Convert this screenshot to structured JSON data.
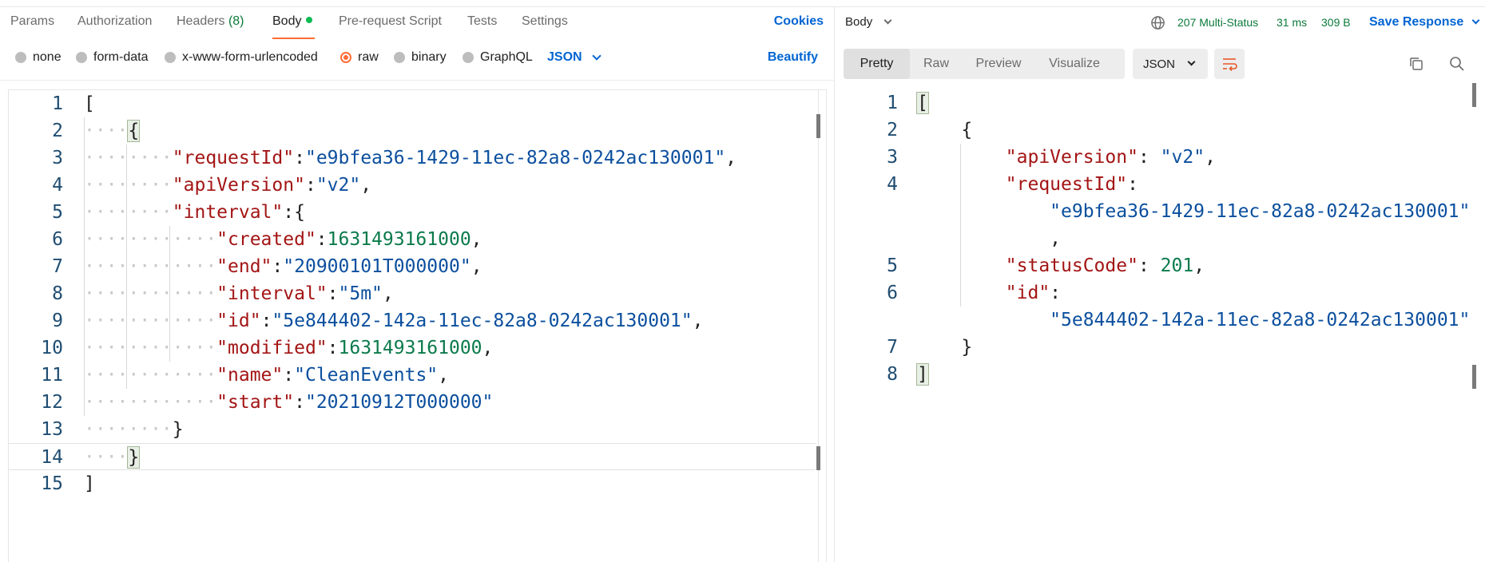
{
  "request_tabs": [
    {
      "label": "Params"
    },
    {
      "label": "Authorization"
    },
    {
      "label": "Headers",
      "count": "(8)"
    },
    {
      "label": "Body"
    },
    {
      "label": "Pre-request Script"
    },
    {
      "label": "Tests"
    },
    {
      "label": "Settings"
    }
  ],
  "cookies_label": "Cookies",
  "body_modes": [
    {
      "label": "none"
    },
    {
      "label": "form-data"
    },
    {
      "label": "x-www-form-urlencoded"
    },
    {
      "label": "raw"
    },
    {
      "label": "binary"
    },
    {
      "label": "GraphQL"
    }
  ],
  "selected_mode": "raw",
  "language": "JSON",
  "beautify_label": "Beautify",
  "request_code": {
    "line_numbers": [
      "1",
      "2",
      "3",
      "4",
      "5",
      "6",
      "7",
      "8",
      "9",
      "10",
      "11",
      "12",
      "13",
      "14",
      "15"
    ],
    "punct": {
      "open_bracket": "[",
      "close_bracket": "]",
      "open_brace": "{",
      "close_brace": "}",
      "colon": ":",
      "comma": ","
    },
    "fields": {
      "requestId_key": "\"requestId\"",
      "requestId_val": "\"e9bfea36-1429-11ec-82a8-0242ac130001\"",
      "apiVersion_key": "\"apiVersion\"",
      "apiVersion_val": "\"v2\"",
      "interval_key": "\"interval\"",
      "created_key": "\"created\"",
      "created_val": "1631493161000",
      "end_key": "\"end\"",
      "end_val": "\"20900101T000000\"",
      "interval_inner_key": "\"interval\"",
      "interval_inner_val": "\"5m\"",
      "id_key": "\"id\"",
      "id_val": "\"5e844402-142a-11ec-82a8-0242ac130001\"",
      "modified_key": "\"modified\"",
      "modified_val": "1631493161000",
      "name_key": "\"name\"",
      "name_val": "\"CleanEvents\"",
      "start_key": "\"start\"",
      "start_val": "\"20210912T000000\""
    }
  },
  "response": {
    "body_label": "Body",
    "status": "207 Multi-Status",
    "time": "31 ms",
    "size": "309 B",
    "save_label": "Save Response",
    "view_tabs": [
      {
        "label": "Pretty"
      },
      {
        "label": "Raw"
      },
      {
        "label": "Preview"
      },
      {
        "label": "Visualize"
      }
    ],
    "format": "JSON",
    "code": {
      "line_numbers": [
        "1",
        "2",
        "3",
        "4",
        "5",
        "6",
        "7",
        "8"
      ],
      "apiVersion_key": "\"apiVersion\"",
      "apiVersion_val": "\"v2\"",
      "requestId_key": "\"requestId\"",
      "requestId_val": "\"e9bfea36-1429-11ec-82a8-0242ac130001\"",
      "statusCode_key": "\"statusCode\"",
      "statusCode_val": "201",
      "id_key": "\"id\"",
      "id_val": "\"5e844402-142a-11ec-82a8-0242ac130001\""
    }
  },
  "colors": {
    "accent": "#ff6c37",
    "link": "#0265d2",
    "success": "#0b7a3b",
    "json_key": "#a31515",
    "json_string": "#0b4f9e",
    "json_number": "#0b7a4b",
    "line_number": "#1f4d72"
  },
  "icons": [
    "globe-icon",
    "chevron-down-icon",
    "wrap-lines-icon",
    "copy-icon",
    "search-icon"
  ]
}
